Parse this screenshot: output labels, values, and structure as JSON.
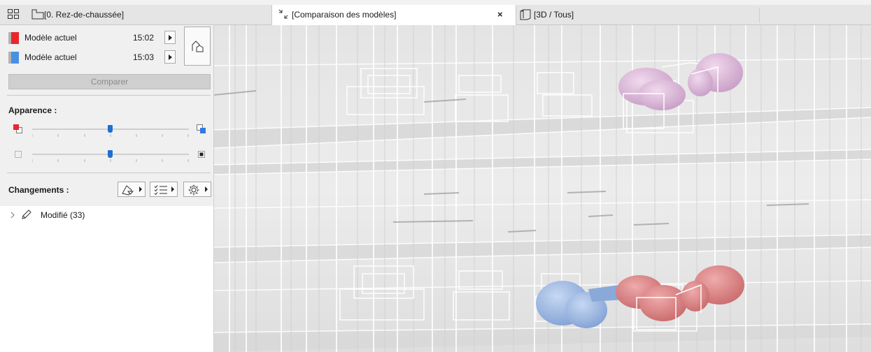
{
  "tabs": {
    "floor_plan_label": "[0. Rez-de-chaussée]",
    "compare_label": "[Comparaison des modèles]",
    "close_symbol": "×",
    "view3d_label": "[3D / Tous]"
  },
  "compare_panel": {
    "models": [
      {
        "name": "Modèle actuel",
        "time": "15:02",
        "color": "#e8262b"
      },
      {
        "name": "Modèle actuel",
        "time": "15:03",
        "color": "#4a90e2"
      }
    ],
    "compare_button": "Comparer",
    "appearance_title": "Apparence :",
    "sliders": [
      {
        "name": "color-balance",
        "value": 0.5
      },
      {
        "name": "transparency",
        "value": 0.5
      }
    ],
    "changes_title": "Changements :",
    "tree_items": [
      {
        "label": "Modifié (33)"
      }
    ]
  },
  "colors": {
    "old_model": "#e8262b",
    "new_model": "#4a90e2",
    "accent": "#1f6fd0"
  }
}
